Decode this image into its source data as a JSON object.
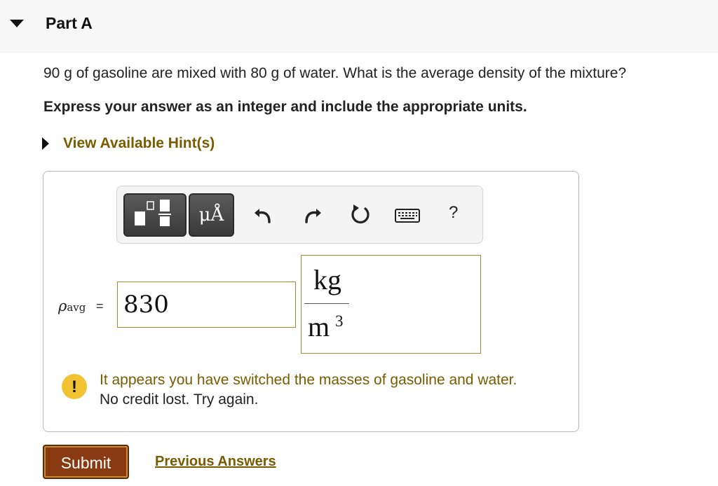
{
  "part": {
    "title": "Part A"
  },
  "question": {
    "prompt": "90 g of gasoline are mixed with 80 g of water. What is the average density of the mixture?",
    "instruction": "Express your answer as an integer and include the appropriate units."
  },
  "hints": {
    "label": "View Available Hint(s)"
  },
  "toolbar": {
    "units_label": "μÅ",
    "help_label": "?",
    "icons": [
      "templates-icon",
      "units-icon",
      "undo-icon",
      "redo-icon",
      "reset-icon",
      "keyboard-icon",
      "help-icon"
    ]
  },
  "answer": {
    "variable": "ρ",
    "subscript": "avg",
    "equals": "=",
    "value": "830",
    "unit_numerator": "kg",
    "unit_denominator": "m",
    "unit_exponent": "3"
  },
  "feedback": {
    "line1": "It appears you have switched the masses of gasoline and water.",
    "line2": "No credit lost. Try again.",
    "icon_mark": "!"
  },
  "actions": {
    "submit_label": "Submit",
    "previous_label": "Previous Answers"
  },
  "colors": {
    "accent": "#7a5c00",
    "submit": "#8a3a10",
    "warning": "#f1c232"
  }
}
